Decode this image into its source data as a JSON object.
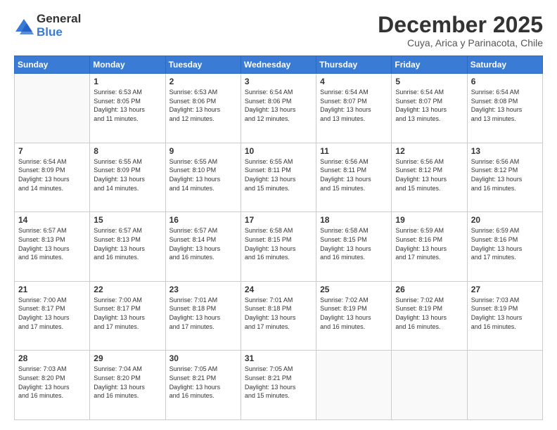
{
  "logo": {
    "general": "General",
    "blue": "Blue"
  },
  "header": {
    "month": "December 2025",
    "location": "Cuya, Arica y Parinacota, Chile"
  },
  "weekdays": [
    "Sunday",
    "Monday",
    "Tuesday",
    "Wednesday",
    "Thursday",
    "Friday",
    "Saturday"
  ],
  "weeks": [
    [
      {
        "day": "",
        "info": ""
      },
      {
        "day": "1",
        "info": "Sunrise: 6:53 AM\nSunset: 8:05 PM\nDaylight: 13 hours\nand 11 minutes."
      },
      {
        "day": "2",
        "info": "Sunrise: 6:53 AM\nSunset: 8:06 PM\nDaylight: 13 hours\nand 12 minutes."
      },
      {
        "day": "3",
        "info": "Sunrise: 6:54 AM\nSunset: 8:06 PM\nDaylight: 13 hours\nand 12 minutes."
      },
      {
        "day": "4",
        "info": "Sunrise: 6:54 AM\nSunset: 8:07 PM\nDaylight: 13 hours\nand 13 minutes."
      },
      {
        "day": "5",
        "info": "Sunrise: 6:54 AM\nSunset: 8:07 PM\nDaylight: 13 hours\nand 13 minutes."
      },
      {
        "day": "6",
        "info": "Sunrise: 6:54 AM\nSunset: 8:08 PM\nDaylight: 13 hours\nand 13 minutes."
      }
    ],
    [
      {
        "day": "7",
        "info": "Sunrise: 6:54 AM\nSunset: 8:09 PM\nDaylight: 13 hours\nand 14 minutes."
      },
      {
        "day": "8",
        "info": "Sunrise: 6:55 AM\nSunset: 8:09 PM\nDaylight: 13 hours\nand 14 minutes."
      },
      {
        "day": "9",
        "info": "Sunrise: 6:55 AM\nSunset: 8:10 PM\nDaylight: 13 hours\nand 14 minutes."
      },
      {
        "day": "10",
        "info": "Sunrise: 6:55 AM\nSunset: 8:11 PM\nDaylight: 13 hours\nand 15 minutes."
      },
      {
        "day": "11",
        "info": "Sunrise: 6:56 AM\nSunset: 8:11 PM\nDaylight: 13 hours\nand 15 minutes."
      },
      {
        "day": "12",
        "info": "Sunrise: 6:56 AM\nSunset: 8:12 PM\nDaylight: 13 hours\nand 15 minutes."
      },
      {
        "day": "13",
        "info": "Sunrise: 6:56 AM\nSunset: 8:12 PM\nDaylight: 13 hours\nand 16 minutes."
      }
    ],
    [
      {
        "day": "14",
        "info": "Sunrise: 6:57 AM\nSunset: 8:13 PM\nDaylight: 13 hours\nand 16 minutes."
      },
      {
        "day": "15",
        "info": "Sunrise: 6:57 AM\nSunset: 8:13 PM\nDaylight: 13 hours\nand 16 minutes."
      },
      {
        "day": "16",
        "info": "Sunrise: 6:57 AM\nSunset: 8:14 PM\nDaylight: 13 hours\nand 16 minutes."
      },
      {
        "day": "17",
        "info": "Sunrise: 6:58 AM\nSunset: 8:15 PM\nDaylight: 13 hours\nand 16 minutes."
      },
      {
        "day": "18",
        "info": "Sunrise: 6:58 AM\nSunset: 8:15 PM\nDaylight: 13 hours\nand 16 minutes."
      },
      {
        "day": "19",
        "info": "Sunrise: 6:59 AM\nSunset: 8:16 PM\nDaylight: 13 hours\nand 17 minutes."
      },
      {
        "day": "20",
        "info": "Sunrise: 6:59 AM\nSunset: 8:16 PM\nDaylight: 13 hours\nand 17 minutes."
      }
    ],
    [
      {
        "day": "21",
        "info": "Sunrise: 7:00 AM\nSunset: 8:17 PM\nDaylight: 13 hours\nand 17 minutes."
      },
      {
        "day": "22",
        "info": "Sunrise: 7:00 AM\nSunset: 8:17 PM\nDaylight: 13 hours\nand 17 minutes."
      },
      {
        "day": "23",
        "info": "Sunrise: 7:01 AM\nSunset: 8:18 PM\nDaylight: 13 hours\nand 17 minutes."
      },
      {
        "day": "24",
        "info": "Sunrise: 7:01 AM\nSunset: 8:18 PM\nDaylight: 13 hours\nand 17 minutes."
      },
      {
        "day": "25",
        "info": "Sunrise: 7:02 AM\nSunset: 8:19 PM\nDaylight: 13 hours\nand 16 minutes."
      },
      {
        "day": "26",
        "info": "Sunrise: 7:02 AM\nSunset: 8:19 PM\nDaylight: 13 hours\nand 16 minutes."
      },
      {
        "day": "27",
        "info": "Sunrise: 7:03 AM\nSunset: 8:19 PM\nDaylight: 13 hours\nand 16 minutes."
      }
    ],
    [
      {
        "day": "28",
        "info": "Sunrise: 7:03 AM\nSunset: 8:20 PM\nDaylight: 13 hours\nand 16 minutes."
      },
      {
        "day": "29",
        "info": "Sunrise: 7:04 AM\nSunset: 8:20 PM\nDaylight: 13 hours\nand 16 minutes."
      },
      {
        "day": "30",
        "info": "Sunrise: 7:05 AM\nSunset: 8:21 PM\nDaylight: 13 hours\nand 16 minutes."
      },
      {
        "day": "31",
        "info": "Sunrise: 7:05 AM\nSunset: 8:21 PM\nDaylight: 13 hours\nand 15 minutes."
      },
      {
        "day": "",
        "info": ""
      },
      {
        "day": "",
        "info": ""
      },
      {
        "day": "",
        "info": ""
      }
    ]
  ]
}
